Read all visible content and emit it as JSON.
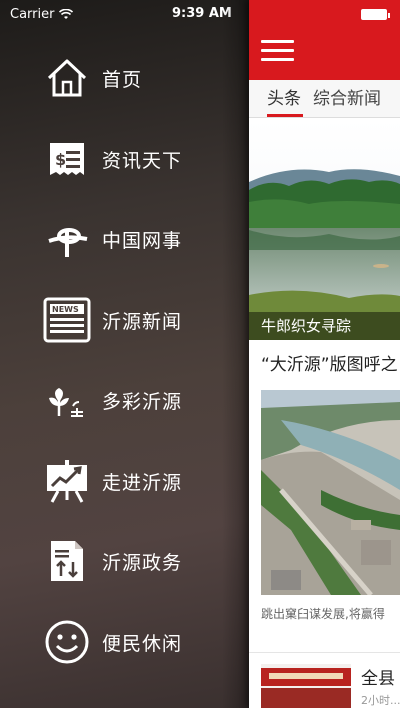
{
  "status_bar": {
    "carrier": "Carrier",
    "time": "9:39 AM"
  },
  "drawer": {
    "items": [
      {
        "label": "首页",
        "icon": "home-icon"
      },
      {
        "label": "资讯天下",
        "icon": "receipt-icon"
      },
      {
        "label": "中国网事",
        "icon": "china-logo-icon"
      },
      {
        "label": "沂源新闻",
        "icon": "news-icon"
      },
      {
        "label": "多彩沂源",
        "icon": "plant-icon"
      },
      {
        "label": "走进沂源",
        "icon": "presentation-chart-icon"
      },
      {
        "label": "沂源政务",
        "icon": "document-sort-icon"
      },
      {
        "label": "便民休闲",
        "icon": "smiley-icon"
      }
    ]
  },
  "content": {
    "tabs": [
      {
        "label": "头条"
      },
      {
        "label": "综合新闻"
      }
    ],
    "news": [
      {
        "caption": "牛郎织女寻踪"
      },
      {
        "headline": "“大沂源”版图呼之",
        "summary": "跳出窠臼谋发展,将赢得"
      },
      {
        "headline": "全县",
        "summary": "2小时..."
      }
    ]
  },
  "colors": {
    "accent_red": "#d8191e",
    "drawer_bg": "#4c403b"
  }
}
